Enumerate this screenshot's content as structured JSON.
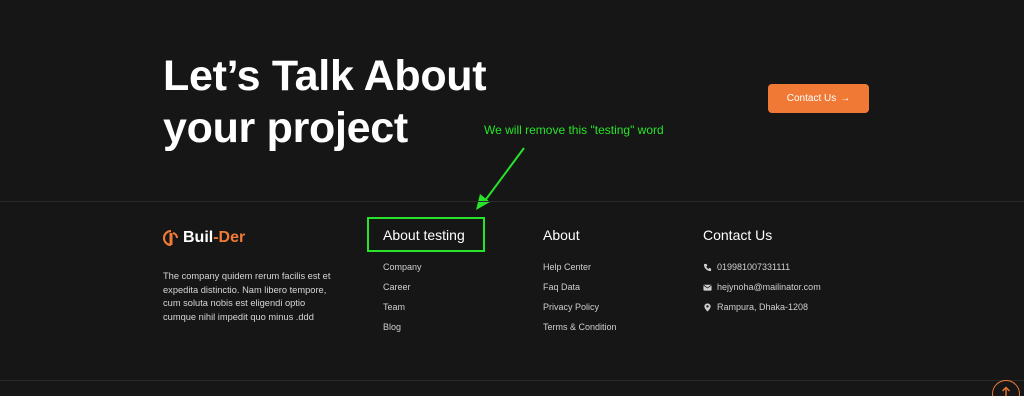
{
  "hero": {
    "line1": "Let’s Talk About",
    "line2": "your project"
  },
  "cta": {
    "label": "Contact Us",
    "arrow": "→"
  },
  "annotation": {
    "text": "We will remove this \"testing\" word",
    "color": "#27e32a"
  },
  "brand": {
    "name_part1": "Buil",
    "hyphen": "-",
    "name_part2": "Der",
    "accent_color": "#f07a35",
    "description": "The company quidem rerum facilis est et expedita distinctio. Nam libero tempore, cum soluta nobis est eligendi optio cumque nihil impedit quo minus .ddd"
  },
  "footer": {
    "testing_col": {
      "heading": "About testing",
      "links": [
        "Company",
        "Career",
        "Team",
        "Blog"
      ]
    },
    "about_col": {
      "heading": "About",
      "links": [
        "Help Center",
        "Faq Data",
        "Privacy Policy",
        "Terms & Condition"
      ]
    },
    "contact_col": {
      "heading": "Contact Us",
      "phone": "019981007331111",
      "email": "hejynoha@mailinator.com",
      "address": "Rampura, Dhaka-1208"
    }
  },
  "icons": {
    "phone": "phone-icon",
    "email": "mail-icon",
    "address": "map-pin-icon",
    "scroll_top": "arrow-up-icon"
  }
}
